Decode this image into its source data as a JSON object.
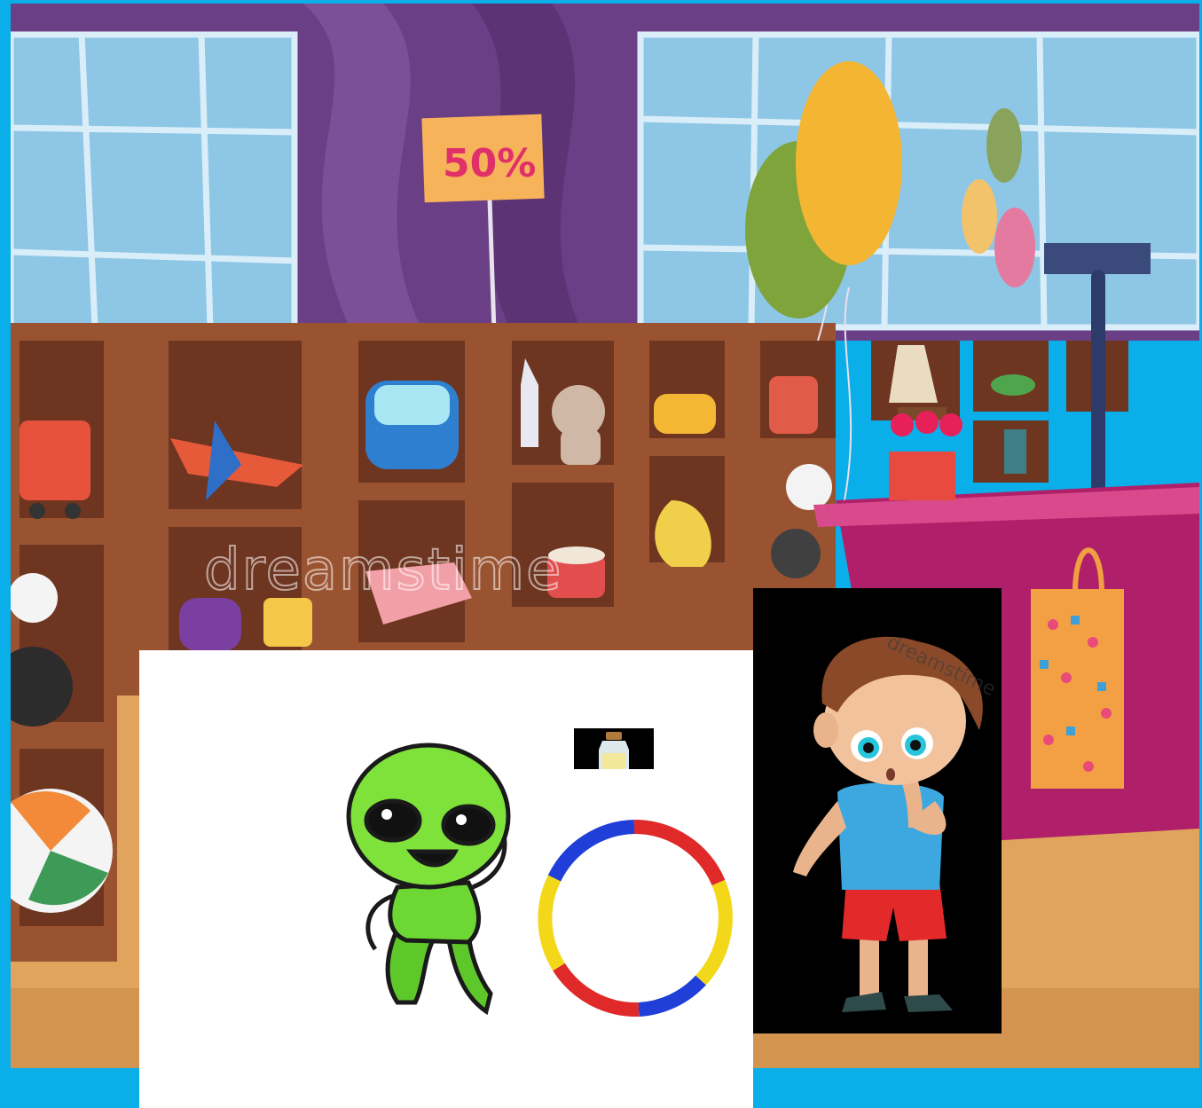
{
  "scene": {
    "sale_sign_text": "50%",
    "watermark_text": "dreamstime",
    "boy_watermark_text": "dreamstime"
  },
  "colors": {
    "frame": "#0aaee8",
    "wall": "#6b3f85",
    "shelf": "#9a5331",
    "counter": "#b0206a",
    "floor": "#e0a45c",
    "window": "#8ec6e6"
  },
  "items": {
    "alien": "alien-sprite",
    "hoop": "hula-hoop-sprite",
    "bottle": "bottle-sprite",
    "boy": "boy-character"
  }
}
